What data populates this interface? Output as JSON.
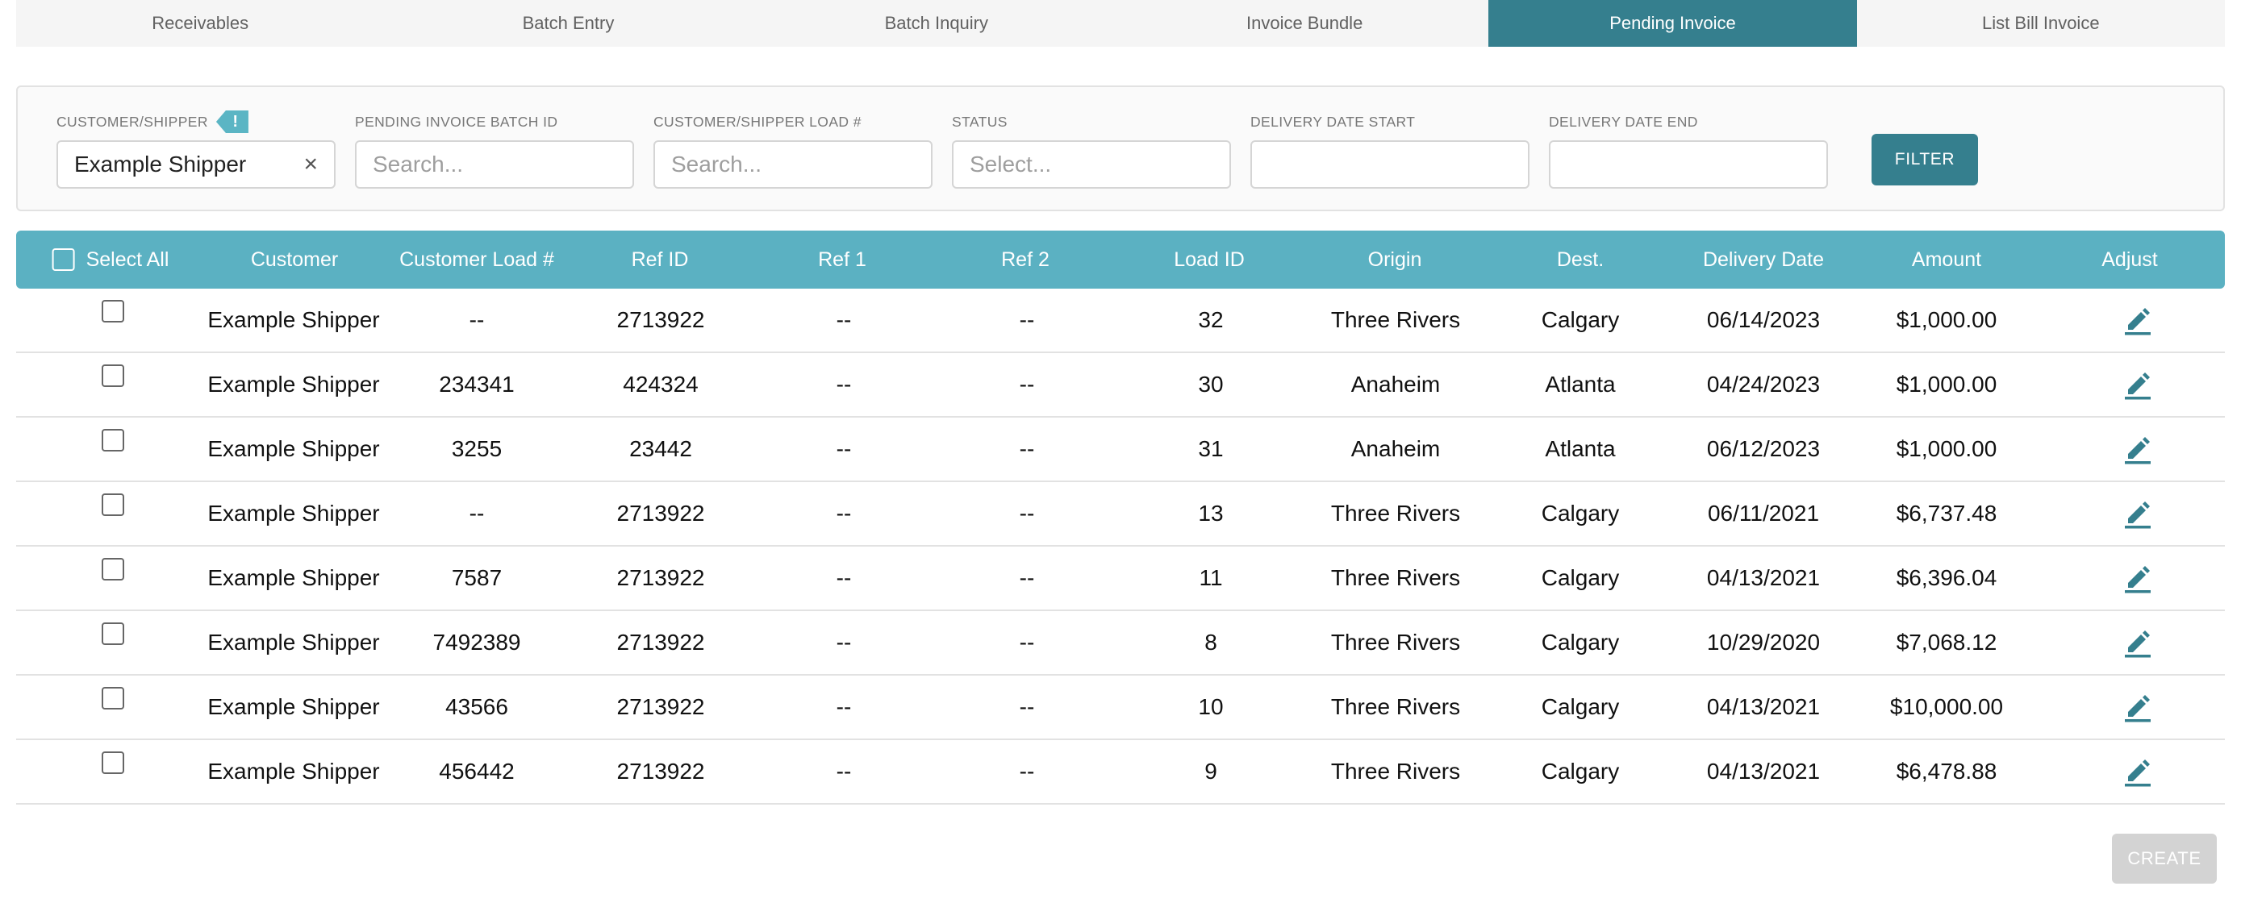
{
  "tabs": [
    {
      "label": "Receivables"
    },
    {
      "label": "Batch Entry"
    },
    {
      "label": "Batch Inquiry"
    },
    {
      "label": "Invoice Bundle"
    },
    {
      "label": "Pending Invoice",
      "active": true
    },
    {
      "label": "List Bill Invoice"
    }
  ],
  "filters": {
    "customer": {
      "label": "CUSTOMER/SHIPPER",
      "value": "Example Shipper",
      "alert": "!"
    },
    "batch_id": {
      "label": "PENDING INVOICE BATCH ID",
      "placeholder": "Search..."
    },
    "load_no": {
      "label": "CUSTOMER/SHIPPER LOAD #",
      "placeholder": "Search..."
    },
    "status": {
      "label": "STATUS",
      "placeholder": "Select..."
    },
    "delivery_start": {
      "label": "DELIVERY DATE START",
      "value": ""
    },
    "delivery_end": {
      "label": "DELIVERY DATE END",
      "value": ""
    },
    "filter_button": "FILTER"
  },
  "table": {
    "headers": [
      "Select All",
      "Customer",
      "Customer Load #",
      "Ref ID",
      "Ref 1",
      "Ref 2",
      "Load ID",
      "Origin",
      "Dest.",
      "Delivery Date",
      "Amount",
      "Adjust"
    ],
    "rows": [
      [
        "Example Shipper",
        "--",
        "2713922",
        "--",
        "--",
        "32",
        "Three Rivers",
        "Calgary",
        "06/14/2023",
        "$1,000.00"
      ],
      [
        "Example Shipper",
        "234341",
        "424324",
        "--",
        "--",
        "30",
        "Anaheim",
        "Atlanta",
        "04/24/2023",
        "$1,000.00"
      ],
      [
        "Example Shipper",
        "3255",
        "23442",
        "--",
        "--",
        "31",
        "Anaheim",
        "Atlanta",
        "06/12/2023",
        "$1,000.00"
      ],
      [
        "Example Shipper",
        "--",
        "2713922",
        "--",
        "--",
        "13",
        "Three Rivers",
        "Calgary",
        "06/11/2021",
        "$6,737.48"
      ],
      [
        "Example Shipper",
        "7587",
        "2713922",
        "--",
        "--",
        "11",
        "Three Rivers",
        "Calgary",
        "04/13/2021",
        "$6,396.04"
      ],
      [
        "Example Shipper",
        "7492389",
        "2713922",
        "--",
        "--",
        "8",
        "Three Rivers",
        "Calgary",
        "10/29/2020",
        "$7,068.12"
      ],
      [
        "Example Shipper",
        "43566",
        "2713922",
        "--",
        "--",
        "10",
        "Three Rivers",
        "Calgary",
        "04/13/2021",
        "$10,000.00"
      ],
      [
        "Example Shipper",
        "456442",
        "2713922",
        "--",
        "--",
        "9",
        "Three Rivers",
        "Calgary",
        "04/13/2021",
        "$6,478.88"
      ]
    ],
    "adjust_icon": "pencil-icon"
  },
  "create_button": "CREATE",
  "colors": {
    "primary": "#357f8e",
    "header": "#5bb1c2",
    "alert": "#5bb5c4",
    "disabled": "#d3d3d3"
  }
}
